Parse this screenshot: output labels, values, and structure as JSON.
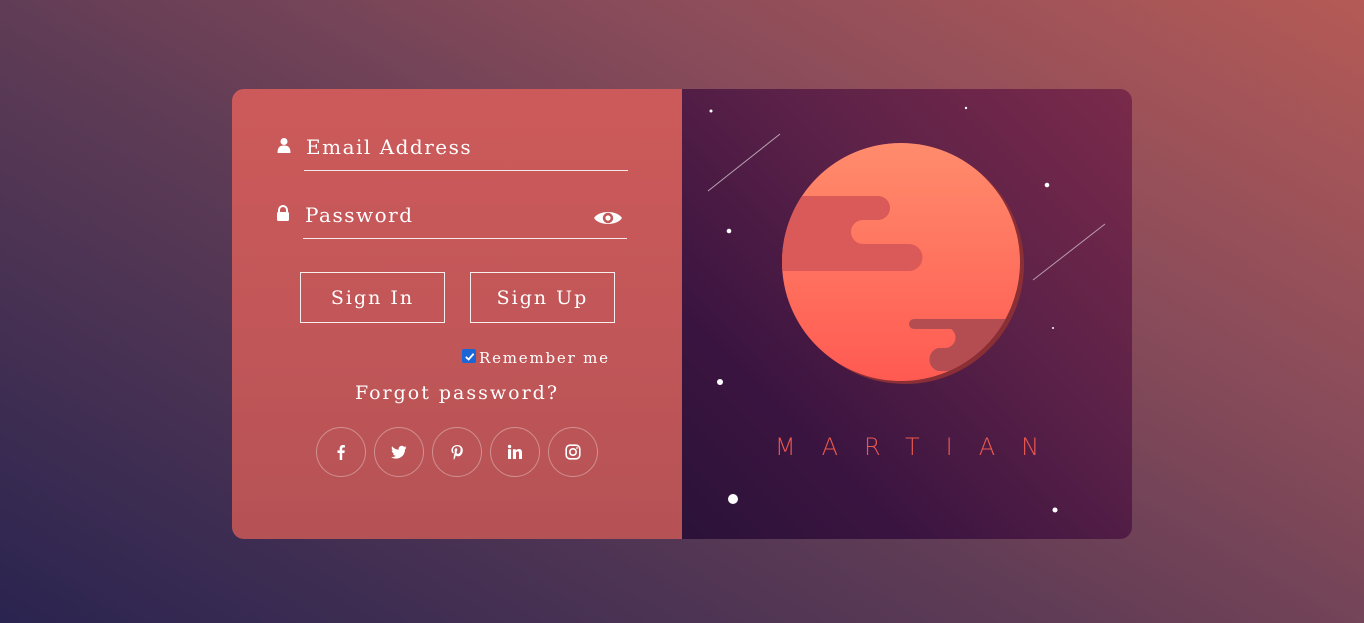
{
  "login": {
    "email_placeholder": "Email Address",
    "password_placeholder": "Password",
    "signin_label": "Sign In",
    "signup_label": "Sign Up",
    "remember_label": "Remember me",
    "remember_checked": true,
    "forgot_label": "Forgot password?"
  },
  "icons": {
    "email": "user-icon",
    "password": "lock-icon",
    "show_password": "eye-icon"
  },
  "socials": [
    {
      "name": "facebook-icon"
    },
    {
      "name": "twitter-icon"
    },
    {
      "name": "pinterest-icon"
    },
    {
      "name": "linkedin-icon"
    },
    {
      "name": "instagram-icon"
    }
  ],
  "brand": {
    "title": "MARTIAN",
    "title_color": "#e8584f"
  },
  "colors": {
    "panel_left": "#c75858",
    "panel_right": "#4a1a44",
    "planet": "#ff7a66",
    "checkbox": "#1a66d6"
  }
}
